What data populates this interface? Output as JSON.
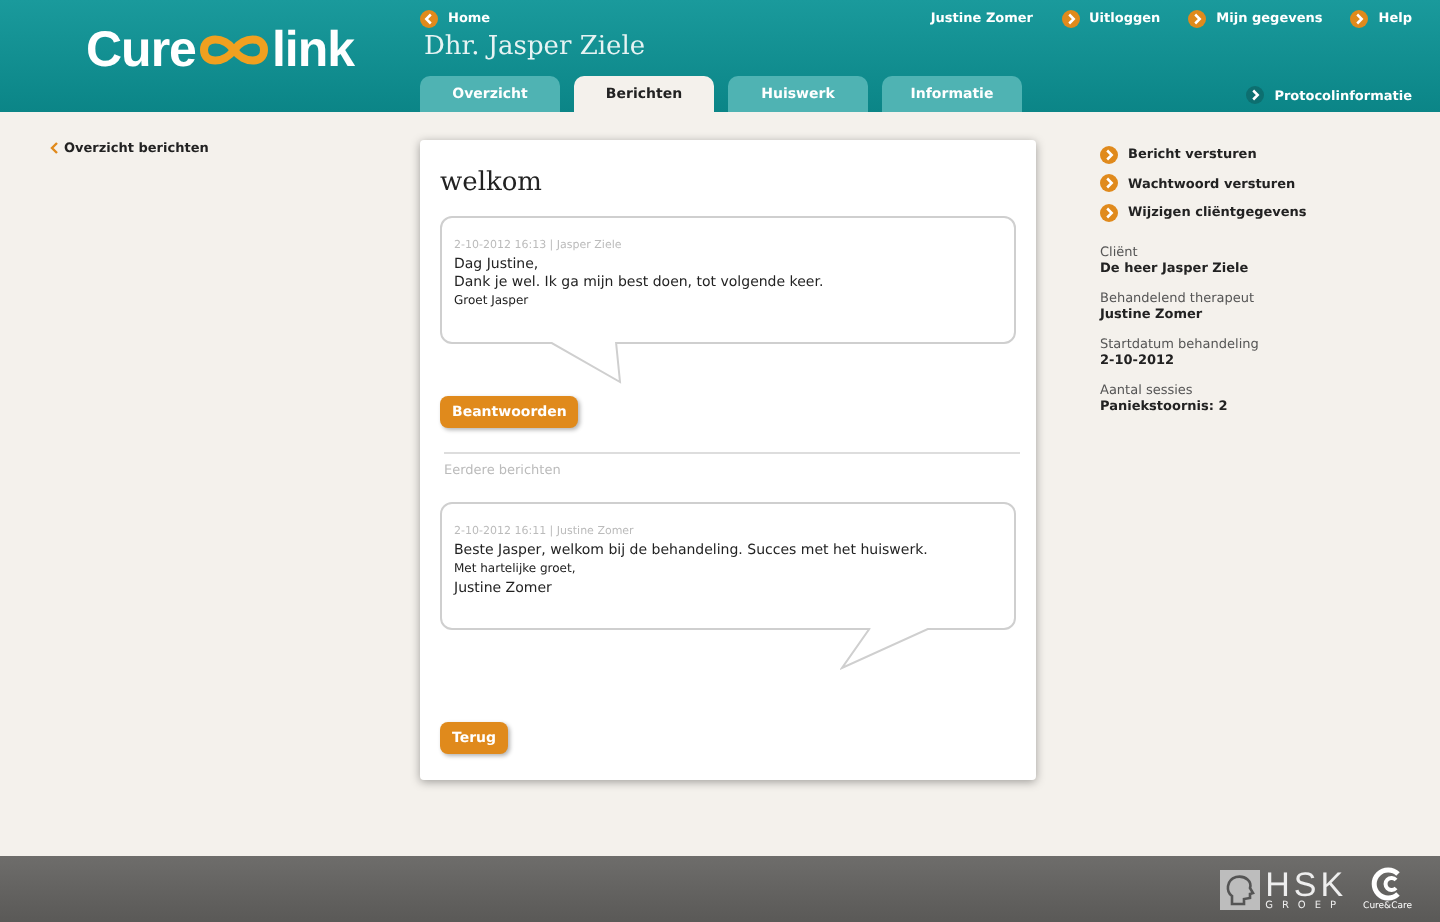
{
  "header": {
    "logo": {
      "left": "Cure",
      "right": "link"
    },
    "home_link": "Home",
    "patient_title": "Dhr. Jasper Ziele",
    "user_name": "Justine Zomer",
    "top_links": [
      "Uitloggen",
      "Mijn gegevens",
      "Help"
    ],
    "tabs": [
      {
        "label": "Overzicht",
        "selected": false
      },
      {
        "label": "Berichten",
        "selected": true
      },
      {
        "label": "Huiswerk",
        "selected": false
      },
      {
        "label": "Informatie",
        "selected": false
      }
    ],
    "protocol_link": "Protocolinformatie"
  },
  "back_link": "Overzicht berichten",
  "card": {
    "title": "welkom",
    "current_message": {
      "meta": "2-10-2012 16:13 | Jasper Ziele",
      "lines": [
        "Dag Justine,",
        "Dank je wel. Ik ga mijn best doen, tot volgende keer."
      ],
      "signature": "Groet Jasper",
      "kind": "received"
    },
    "reply_button": "Beantwoorden",
    "earlier_heading": "Eerdere berichten",
    "earlier_messages": [
      {
        "meta": "2-10-2012 16:11 | Justine Zomer",
        "lines": [
          "Beste Jasper, welkom bij de behandeling. Succes met het huiswerk."
        ],
        "signature": "Met hartelijke groet,",
        "closing": "Justine Zomer",
        "kind": "sent"
      }
    ],
    "back_button": "Terug"
  },
  "actions": [
    "Bericht versturen",
    "Wachtwoord versturen",
    "Wijzigen cliëntgegevens"
  ],
  "details": [
    {
      "label": "Cliënt",
      "value": "De heer Jasper Ziele"
    },
    {
      "label": "Behandelend therapeut",
      "value": "Justine Zomer"
    },
    {
      "label": "Startdatum behandeling",
      "value": "2-10-2012"
    },
    {
      "label": "Aantal sessies",
      "value": "Paniekstoornis: 2"
    }
  ],
  "footer": {
    "group_logo": {
      "name": "HSK",
      "sub": "GROEP"
    },
    "brand_logo": "Cure&Care"
  }
}
